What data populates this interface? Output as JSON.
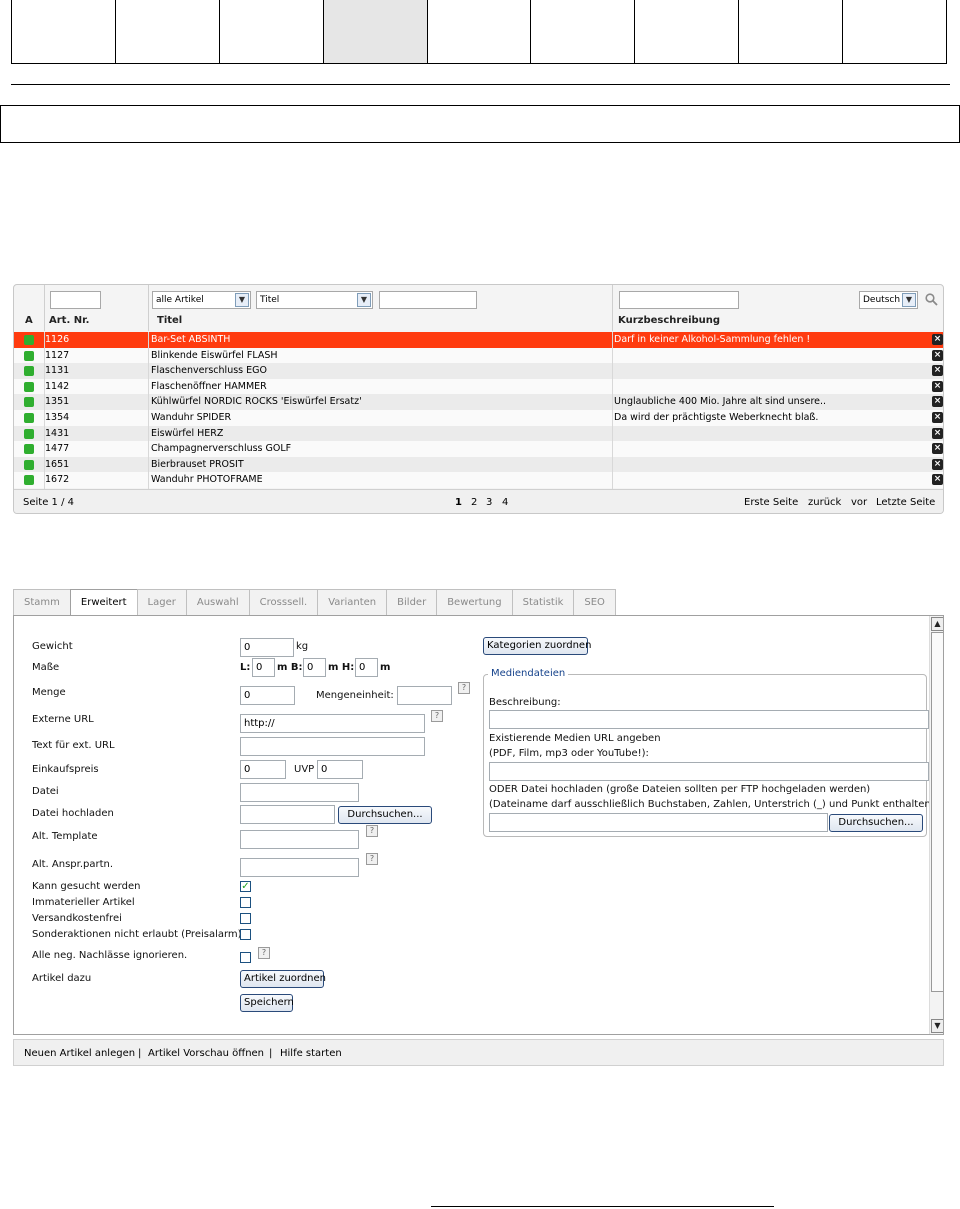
{
  "list": {
    "header": {
      "col_a": "A",
      "col_art_nr": "Art. Nr.",
      "col_titel": "Titel",
      "col_kurz": "Kurzbeschreibung",
      "filter_type": "alle Artikel",
      "filter_field": "Titel",
      "language": "Deutsch"
    },
    "rows": [
      {
        "nr": "1126",
        "titel": "Bar-Set ABSINTH",
        "kurz": "Darf in keiner Alkohol-Sammlung fehlen !"
      },
      {
        "nr": "1127",
        "titel": "Blinkende Eiswürfel FLASH",
        "kurz": ""
      },
      {
        "nr": "1131",
        "titel": "Flaschenverschluss EGO",
        "kurz": ""
      },
      {
        "nr": "1142",
        "titel": "Flaschenöffner HAMMER",
        "kurz": ""
      },
      {
        "nr": "1351",
        "titel": "Kühlwürfel NORDIC ROCKS 'Eiswürfel Ersatz'",
        "kurz": "Unglaubliche 400 Mio. Jahre alt sind unsere.."
      },
      {
        "nr": "1354",
        "titel": "Wanduhr SPIDER",
        "kurz": "Da wird der prächtigste Weberknecht blaß."
      },
      {
        "nr": "1431",
        "titel": "Eiswürfel HERZ",
        "kurz": ""
      },
      {
        "nr": "1477",
        "titel": "Champagnerverschluss GOLF",
        "kurz": ""
      },
      {
        "nr": "1651",
        "titel": "Bierbrauset PROSIT",
        "kurz": ""
      },
      {
        "nr": "1672",
        "titel": "Wanduhr PHOTOFRAME",
        "kurz": ""
      }
    ],
    "pager": {
      "page_info": "Seite 1 / 4",
      "pages": [
        "1",
        "2",
        "3",
        "4"
      ],
      "first": "Erste Seite",
      "back": "zurück",
      "next": "vor",
      "last": "Letzte Seite"
    }
  },
  "tabs": [
    "Stamm",
    "Erweitert",
    "Lager",
    "Auswahl",
    "Crosssell.",
    "Varianten",
    "Bilder",
    "Bewertung",
    "Statistik",
    "SEO"
  ],
  "form": {
    "gewicht_label": "Gewicht",
    "gewicht_value": "0",
    "gewicht_unit": "kg",
    "masse_label": "Maße",
    "l_label": "L:",
    "l_value": "0",
    "b_label": "m B:",
    "b_value": "0",
    "h_label": "m H:",
    "h_value": "0",
    "m_unit": "m",
    "menge_label": "Menge",
    "menge_value": "0",
    "mengeneinheit_label": "Mengeneinheit:",
    "ext_url_label": "Externe URL",
    "ext_url_value": "http://",
    "text_ext_url_label": "Text für ext. URL",
    "einkaufspreis_label": "Einkaufspreis",
    "einkaufspreis_value": "0",
    "uvp_label": "UVP",
    "uvp_value": "0",
    "datei_label": "Datei",
    "datei_hochladen_label": "Datei hochladen",
    "durchsuchen": "Durchsuchen...",
    "alt_template_label": "Alt. Template",
    "alt_anspr_label": "Alt. Anspr.partn.",
    "kann_gesucht_label": "Kann gesucht werden",
    "immateriell_label": "Immaterieller Artikel",
    "versandkostenfrei_label": "Versandkostenfrei",
    "sonderaktionen_label": "Sonderaktionen nicht erlaubt (Preisalarm)",
    "nachlaesse_label": "Alle neg. Nachlässe ignorieren.",
    "artikel_dazu_label": "Artikel dazu",
    "artikel_zuordnen": "Artikel zuordnen",
    "speichern": "Speichern",
    "kategorien_zuordnen": "Kategorien zuordnen",
    "help_glyph": "?",
    "check_glyph": "✓"
  },
  "media": {
    "legend": "Mediendateien",
    "beschreibung_label": "Beschreibung:",
    "existing_url_label": "Existierende Medien URL angeben",
    "existing_url_hint": "(PDF, Film, mp3 oder YouTube!):",
    "upload_label": "ODER Datei hochladen (große Dateien sollten per FTP hochgeladen werden)",
    "upload_hint": "(Dateiname darf ausschließlich Buchstaben, Zahlen, Unterstrich (_) und Punkt enthalten.:",
    "durchsuchen": "Durchsuchen..."
  },
  "footer": {
    "new_article": "Neuen Artikel anlegen",
    "preview": "Artikel Vorschau öffnen",
    "help": "Hilfe starten",
    "sep": "|"
  },
  "colors": {
    "selected_row": "#ff3b0f",
    "status_active": "#2fae2f",
    "legend_text": "#15428b"
  },
  "icons": {
    "search": "magnifier-icon",
    "delete": "close-icon",
    "status": "status-dot-icon"
  }
}
